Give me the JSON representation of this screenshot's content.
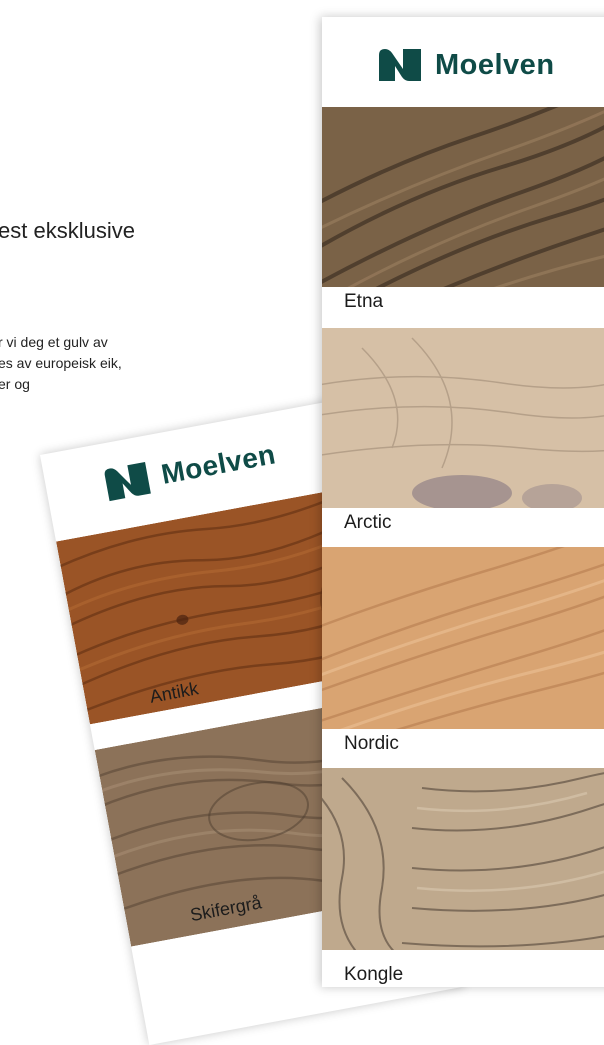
{
  "intro": {
    "heading": "est eksklusive",
    "paragraph_lines": [
      "r vi deg et gulv av",
      "es av europeisk eik,",
      "er og"
    ]
  },
  "brand": {
    "name": "Moelven",
    "color": "#0f4b47"
  },
  "right_brochure": {
    "swatches": [
      {
        "name": "Etna",
        "base": "#7a6247",
        "grain": "#3b2d22"
      },
      {
        "name": "Arctic",
        "base": "#d6c0a6",
        "grain": "#8e7a66"
      },
      {
        "name": "Nordic",
        "base": "#d9a472",
        "grain": "#b37a4c"
      },
      {
        "name": "Kongle",
        "base": "#bfa98d",
        "grain": "#5a4c3f"
      }
    ]
  },
  "left_brochure": {
    "swatches": [
      {
        "name": "Antikk",
        "base": "#9a5426",
        "grain": "#5e2d12"
      },
      {
        "name": "Skifergrå",
        "base": "#8c7259",
        "grain": "#5d4a39"
      }
    ]
  }
}
